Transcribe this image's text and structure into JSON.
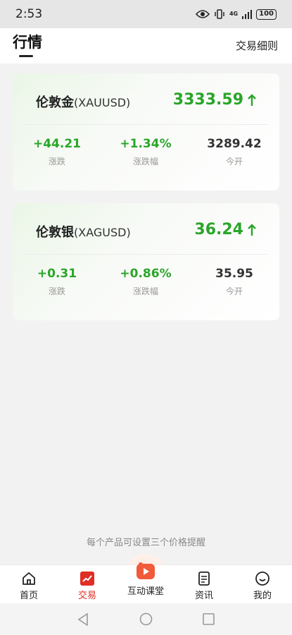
{
  "status": {
    "time": "2:53",
    "network": "4G",
    "battery": "100"
  },
  "header": {
    "title": "行情",
    "rules_link": "交易细则"
  },
  "cards": [
    {
      "name": "伦敦金",
      "code": "(XAUUSD)",
      "price": "3333.59",
      "change": "+44.21",
      "change_label": "涨跌",
      "percent": "+1.34%",
      "percent_label": "涨跌幅",
      "open": "3289.42",
      "open_label": "今开"
    },
    {
      "name": "伦敦银",
      "code": "(XAGUSD)",
      "price": "36.24",
      "change": "+0.31",
      "change_label": "涨跌",
      "percent": "+0.86%",
      "percent_label": "涨跌幅",
      "open": "35.95",
      "open_label": "今开"
    }
  ],
  "hint": "每个产品可设置三个价格提醒",
  "tabs": [
    {
      "label": "首页",
      "icon": "home-icon"
    },
    {
      "label": "交易",
      "icon": "trade-icon",
      "active": true
    },
    {
      "label": "互动课堂",
      "icon": "video-class-icon"
    },
    {
      "label": "资讯",
      "icon": "news-icon"
    },
    {
      "label": "我的",
      "icon": "profile-icon"
    }
  ],
  "colors": {
    "up": "#2aa52a",
    "accent": "#e02e24"
  }
}
